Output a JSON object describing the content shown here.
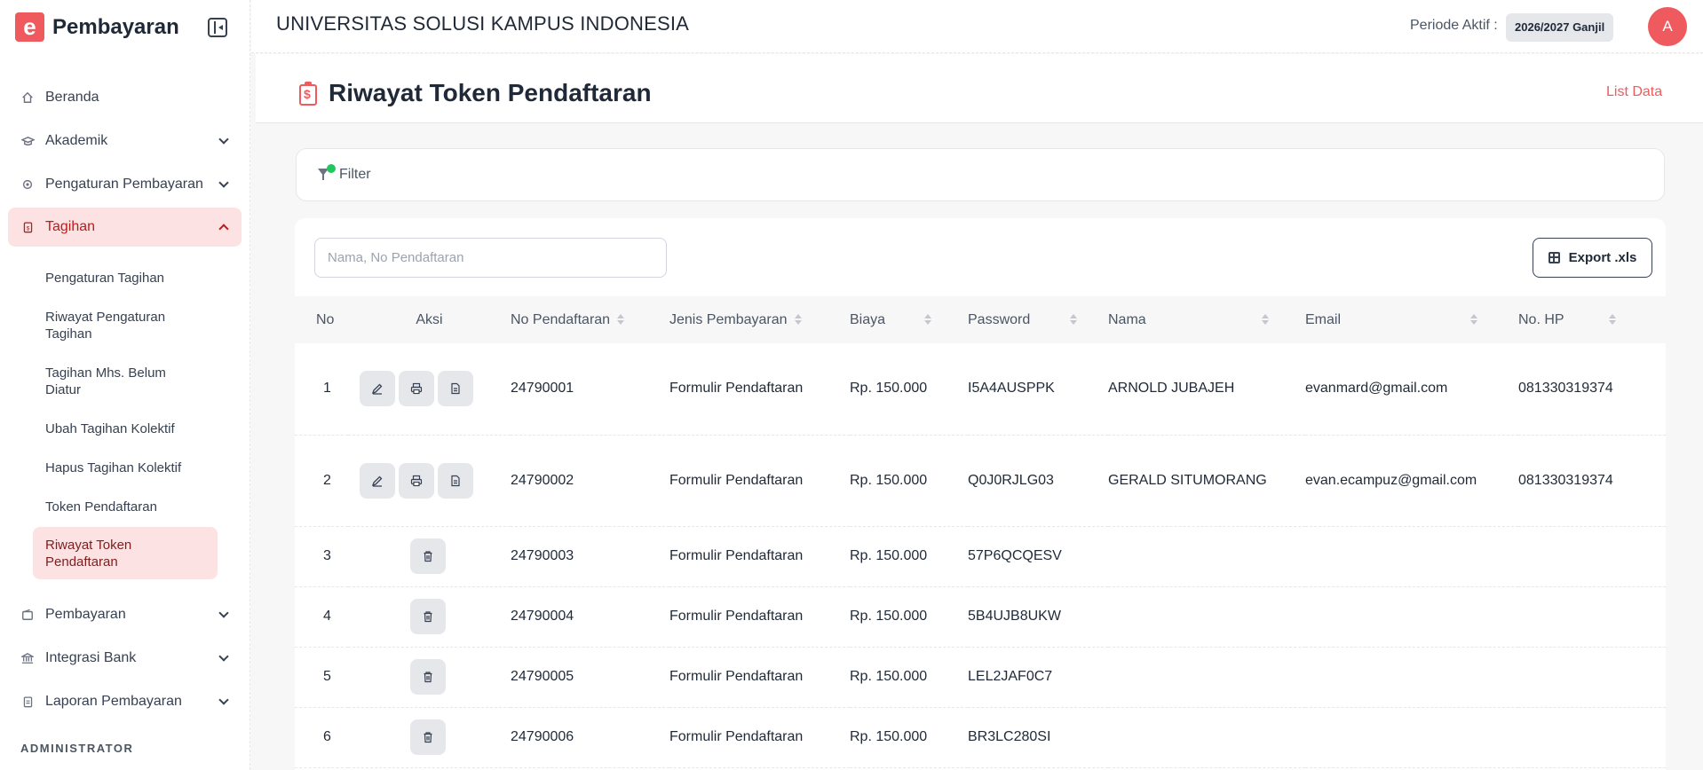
{
  "sidebar": {
    "brand": {
      "logo_letter": "e",
      "name": "Pembayaran"
    },
    "items": [
      {
        "label": "Beranda",
        "icon": "home-icon"
      },
      {
        "label": "Akademik",
        "icon": "graduation-cap-icon"
      },
      {
        "label": "Pengaturan Pembayaran",
        "icon": "settings-cog-icon"
      },
      {
        "label": "Tagihan",
        "icon": "invoice-icon",
        "active": true
      },
      {
        "label": "Pembayaran",
        "icon": "wallet-icon"
      },
      {
        "label": "Integrasi Bank",
        "icon": "bank-icon"
      },
      {
        "label": "Laporan Pembayaran",
        "icon": "report-icon"
      }
    ],
    "sub_items": [
      {
        "label": "Pengaturan Tagihan"
      },
      {
        "label": "Riwayat Pengaturan Tagihan"
      },
      {
        "label": "Tagihan Mhs. Belum Diatur"
      },
      {
        "label": "Ubah Tagihan Kolektif"
      },
      {
        "label": "Hapus Tagihan Kolektif"
      },
      {
        "label": "Token Pendaftaran"
      },
      {
        "label": "Riwayat Token Pendaftaran",
        "active": true
      }
    ],
    "section_label": "ADMINISTRATOR"
  },
  "header": {
    "university": "UNIVERSITAS SOLUSI KAMPUS INDONESIA",
    "periode_label": "Periode Aktif :",
    "periode_value": "2026/2027 Ganjil",
    "avatar_initial": "A"
  },
  "page": {
    "title": "Riwayat Token Pendaftaran",
    "list_data_link": "List Data",
    "filter_label": "Filter",
    "search_placeholder": "Nama, No Pendaftaran",
    "export_label": "Export .xls"
  },
  "table": {
    "columns": [
      "No",
      "Aksi",
      "No Pendaftaran",
      "Jenis Pembayaran",
      "Biaya",
      "Password",
      "Nama",
      "Email",
      "No. HP"
    ],
    "rows": [
      {
        "no": "1",
        "actions": [
          "edit",
          "print",
          "document"
        ],
        "no_pendaftaran": "24790001",
        "jenis": "Formulir Pendaftaran",
        "biaya": "Rp. 150.000",
        "password": "I5A4AUSPPK",
        "nama": "ARNOLD JUBAJEH",
        "email": "evanmard@gmail.com",
        "hp": "081330319374"
      },
      {
        "no": "2",
        "actions": [
          "edit",
          "print",
          "document"
        ],
        "no_pendaftaran": "24790002",
        "jenis": "Formulir Pendaftaran",
        "biaya": "Rp. 150.000",
        "password": "Q0J0RJLG03",
        "nama": "GERALD SITUMORANG",
        "email": "evan.ecampuz@gmail.com",
        "hp": "081330319374"
      },
      {
        "no": "3",
        "actions": [
          "delete"
        ],
        "no_pendaftaran": "24790003",
        "jenis": "Formulir Pendaftaran",
        "biaya": "Rp. 150.000",
        "password": "57P6QCQESV",
        "nama": "",
        "email": "",
        "hp": ""
      },
      {
        "no": "4",
        "actions": [
          "delete"
        ],
        "no_pendaftaran": "24790004",
        "jenis": "Formulir Pendaftaran",
        "biaya": "Rp. 150.000",
        "password": "5B4UJB8UKW",
        "nama": "",
        "email": "",
        "hp": ""
      },
      {
        "no": "5",
        "actions": [
          "delete"
        ],
        "no_pendaftaran": "24790005",
        "jenis": "Formulir Pendaftaran",
        "biaya": "Rp. 150.000",
        "password": "LEL2JAF0C7",
        "nama": "",
        "email": "",
        "hp": ""
      },
      {
        "no": "6",
        "actions": [
          "delete"
        ],
        "no_pendaftaran": "24790006",
        "jenis": "Formulir Pendaftaran",
        "biaya": "Rp. 150.000",
        "password": "BR3LC280SI",
        "nama": "",
        "email": "",
        "hp": ""
      }
    ]
  },
  "colors": {
    "accent": "#ef5a5f",
    "active_bg": "#fde2e4",
    "status_dot": "#22c55e"
  }
}
